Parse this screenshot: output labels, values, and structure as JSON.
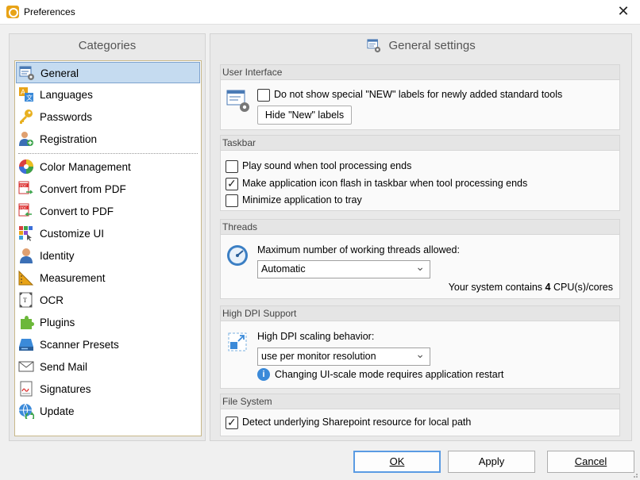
{
  "window": {
    "title": "Preferences"
  },
  "categories": {
    "header": "Categories",
    "items": [
      {
        "label": "General",
        "icon": "general-settings-icon",
        "selected": true
      },
      {
        "label": "Languages",
        "icon": "languages-icon"
      },
      {
        "label": "Passwords",
        "icon": "key-icon"
      },
      {
        "label": "Registration",
        "icon": "registration-icon"
      },
      {
        "label": "Color Management",
        "icon": "color-wheel-icon"
      },
      {
        "label": "Convert from PDF",
        "icon": "convert-from-pdf-icon"
      },
      {
        "label": "Convert to PDF",
        "icon": "convert-to-pdf-icon"
      },
      {
        "label": "Customize UI",
        "icon": "customize-ui-icon"
      },
      {
        "label": "Identity",
        "icon": "identity-icon"
      },
      {
        "label": "Measurement",
        "icon": "measurement-icon"
      },
      {
        "label": "OCR",
        "icon": "ocr-icon"
      },
      {
        "label": "Plugins",
        "icon": "plugins-icon"
      },
      {
        "label": "Scanner Presets",
        "icon": "scanner-icon"
      },
      {
        "label": "Send Mail",
        "icon": "mail-icon"
      },
      {
        "label": "Signatures",
        "icon": "signature-icon"
      },
      {
        "label": "Update",
        "icon": "update-icon"
      }
    ]
  },
  "settings": {
    "header": "General settings",
    "user_interface": {
      "title": "User Interface",
      "new_labels_checkbox": "Do not show special \"NEW\" labels for newly added standard tools",
      "new_labels_checked": false,
      "hide_button": "Hide \"New\" labels"
    },
    "taskbar": {
      "title": "Taskbar",
      "play_sound": "Play sound when tool processing ends",
      "play_sound_checked": false,
      "flash_icon": "Make application icon flash in taskbar when tool processing ends",
      "flash_icon_checked": true,
      "minimize_tray": "Minimize application to tray",
      "minimize_tray_checked": false
    },
    "threads": {
      "title": "Threads",
      "label": "Maximum number of working threads allowed:",
      "selected": "Automatic",
      "cpu_prefix": "Your system contains",
      "cpu_count": "4",
      "cpu_suffix": "CPU(s)/cores"
    },
    "high_dpi": {
      "title": "High DPI Support",
      "label": "High DPI scaling behavior:",
      "selected": "use per monitor resolution",
      "info": "Changing UI-scale mode requires application restart"
    },
    "file_system": {
      "title": "File System",
      "detect_sharepoint": "Detect underlying Sharepoint resource for local path",
      "detect_sharepoint_checked": true
    }
  },
  "footer": {
    "ok": "OK",
    "apply": "Apply",
    "cancel": "Cancel"
  }
}
